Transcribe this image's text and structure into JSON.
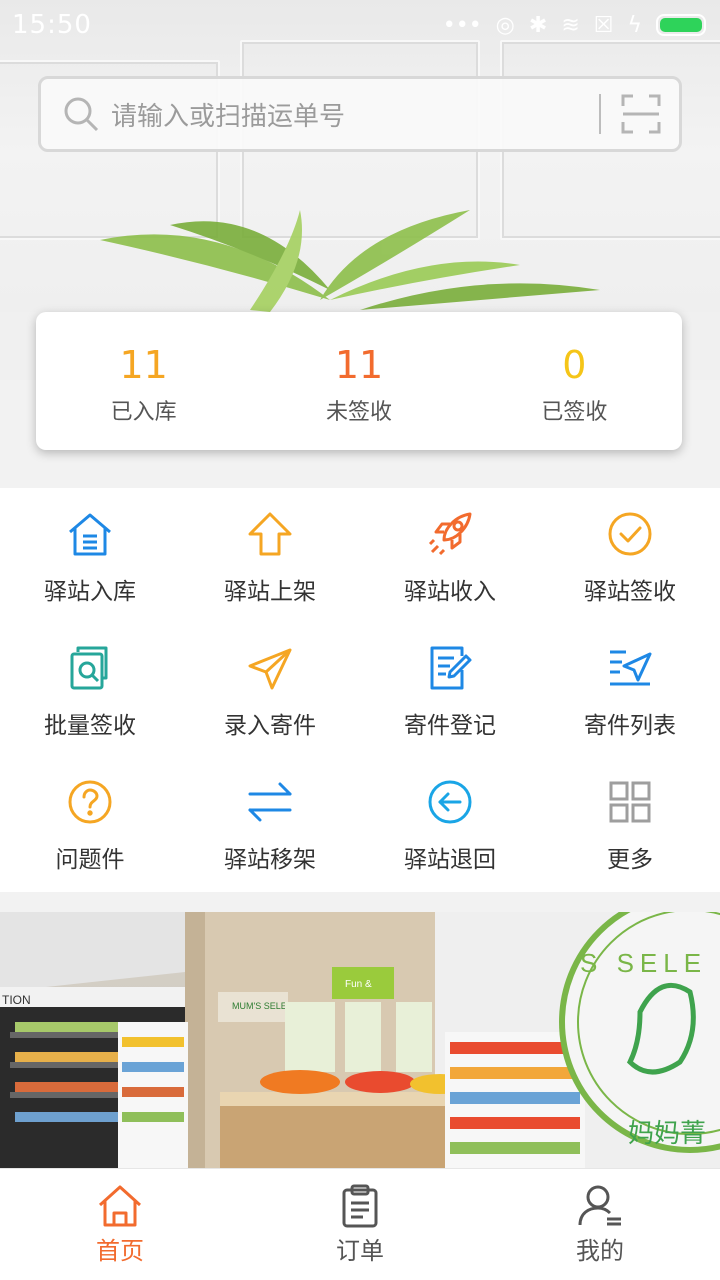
{
  "status_bar": {
    "time": "15:50"
  },
  "search": {
    "placeholder": "请输入或扫描运单号"
  },
  "stats": [
    {
      "value": "11",
      "label": "已入库",
      "color": "#f5a623"
    },
    {
      "value": "11",
      "label": "未签收",
      "color": "#f26b2e"
    },
    {
      "value": "0",
      "label": "已签收",
      "color": "#f5c518"
    }
  ],
  "grid": [
    {
      "label": "驿站入库",
      "icon": "warehouse-icon",
      "color": "#1e88e5"
    },
    {
      "label": "驿站上架",
      "icon": "arrow-up-icon",
      "color": "#f5a623"
    },
    {
      "label": "驿站收入",
      "icon": "rocket-icon",
      "color": "#f26b2e"
    },
    {
      "label": "驿站签收",
      "icon": "check-circle-icon",
      "color": "#f5a623"
    },
    {
      "label": "批量签收",
      "icon": "doc-search-icon",
      "color": "#26a69a"
    },
    {
      "label": "录入寄件",
      "icon": "paper-plane-icon",
      "color": "#f5a623"
    },
    {
      "label": "寄件登记",
      "icon": "edit-doc-icon",
      "color": "#1e88e5"
    },
    {
      "label": "寄件列表",
      "icon": "send-list-icon",
      "color": "#1e88e5"
    },
    {
      "label": "问题件",
      "icon": "question-circle-icon",
      "color": "#f5a623"
    },
    {
      "label": "驿站移架",
      "icon": "swap-arrows-icon",
      "color": "#1e88e5"
    },
    {
      "label": "驿站退回",
      "icon": "return-circle-icon",
      "color": "#1aa5e6"
    },
    {
      "label": "更多",
      "icon": "grid-more-icon",
      "color": "#9e9e9e"
    }
  ],
  "banner": {
    "sign_text": "MUM'S SELECTION",
    "fun_text": "Fun &",
    "seal_text": "S SELE",
    "seal_cn": "妈妈菁"
  },
  "bottom_nav": [
    {
      "label": "首页",
      "icon": "home-icon",
      "active": true
    },
    {
      "label": "订单",
      "icon": "clipboard-icon",
      "active": false
    },
    {
      "label": "我的",
      "icon": "user-icon",
      "active": false
    }
  ],
  "colors": {
    "accent": "#f26b2e",
    "nav_inactive": "#555555"
  }
}
